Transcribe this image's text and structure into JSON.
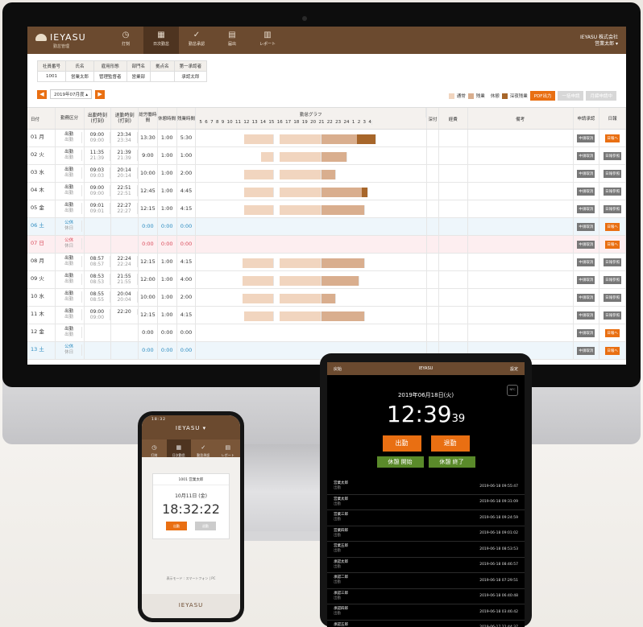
{
  "desktop": {
    "logo": "IEYASU",
    "logo_sub": "勤怠管理",
    "nav": [
      {
        "label": "打刻",
        "icon": "clock-icon"
      },
      {
        "label": "日次勤怠",
        "icon": "calendar-icon",
        "active": true
      },
      {
        "label": "勤怠承認",
        "icon": "check-icon"
      },
      {
        "label": "届出",
        "icon": "doc-icon"
      },
      {
        "label": "レポート",
        "icon": "report-icon"
      }
    ],
    "company": "IEYASU 株式会社",
    "user": "営業太郎 ▾",
    "employee_headers": [
      "社員番号",
      "氏名",
      "雇用形態",
      "部門名",
      "拠点名",
      "第一承認者"
    ],
    "employee_values": [
      "1001",
      "営業太郎",
      "管理監督者",
      "営業部",
      "",
      "承認太郎"
    ],
    "month": "2019年07月度 ▴",
    "legend": {
      "normal": "通常",
      "overtime": "残業",
      "rest": "休憩",
      "late": "深夜残業"
    },
    "pdf": "PDF出力",
    "bulk": "一括申請",
    "monthly": "月締申請中",
    "headers": {
      "date": "日付",
      "type": "勤務区分",
      "in": "出勤時刻 (打刻)",
      "out": "退勤時刻 (打刻)",
      "total": "総労働時間",
      "rest": "休憩時間",
      "over": "残業時間",
      "graph": "勤怠グラフ",
      "hours": "5 6 7 8 9 10 11 12 13 14 15 16 17 18 19 20 21 22 23 24 1 2 3 4",
      "tc": "深付",
      "cost": "経費",
      "note": "備考",
      "approve": "申請承認",
      "daily": "日報"
    },
    "rows": [
      {
        "d": "01 月",
        "t1": "出勤",
        "t2": "出勤",
        "i1": "09:00",
        "i2": "09:00",
        "o1": "23:34",
        "o2": "23:34",
        "tot": "13:30",
        "rest": "1:00",
        "ov": "5:30",
        "a": "中請取消",
        "r": "日報へ",
        "cls": "",
        "s": 0.205,
        "e": 0.772,
        "late": 0.69
      },
      {
        "d": "02 火",
        "t1": "出勤",
        "t2": "出勤",
        "i1": "11:35",
        "i2": "21:39",
        "o1": "21:39",
        "o2": "21:39",
        "tot": "9:00",
        "rest": "1:00",
        "ov": "1:00",
        "a": "中請取消",
        "r": "日報参照",
        "cls": "",
        "s": 0.28,
        "e": 0.65,
        "late": 0
      },
      {
        "d": "03 水",
        "t1": "出勤",
        "t2": "出勤",
        "i1": "09:03",
        "i2": "09:03",
        "o1": "20:14",
        "o2": "20:14",
        "tot": "10:00",
        "rest": "1:00",
        "ov": "2:00",
        "a": "中請取消",
        "r": "日報参照",
        "cls": "",
        "s": 0.205,
        "e": 0.6,
        "late": 0
      },
      {
        "d": "04 木",
        "t1": "出勤",
        "t2": "出勤",
        "i1": "09:00",
        "i2": "09:00",
        "o1": "22:51",
        "o2": "22:51",
        "tot": "12:45",
        "rest": "1:00",
        "ov": "4:45",
        "a": "中請取消",
        "r": "日報参照",
        "cls": "",
        "s": 0.205,
        "e": 0.74,
        "late": 0.71
      },
      {
        "d": "05 金",
        "t1": "出勤",
        "t2": "出勤",
        "i1": "09:01",
        "i2": "09:01",
        "o1": "22:27",
        "o2": "22:27",
        "tot": "12:15",
        "rest": "1:00",
        "ov": "4:15",
        "a": "中請取消",
        "r": "日報参照",
        "cls": "",
        "s": 0.205,
        "e": 0.725,
        "late": 0
      },
      {
        "d": "06 土",
        "t1": "公休",
        "t2": "休日",
        "i1": "",
        "i2": "",
        "o1": "",
        "o2": "",
        "tot": "0:00",
        "rest": "0:00",
        "ov": "0:00",
        "a": "中請取消",
        "r": "日報へ",
        "cls": "blue",
        "s": 0,
        "e": 0,
        "late": 0
      },
      {
        "d": "07 日",
        "t1": "公休",
        "t2": "休日",
        "i1": "",
        "i2": "",
        "o1": "",
        "o2": "",
        "tot": "0:00",
        "rest": "0:00",
        "ov": "0:00",
        "a": "中請取消",
        "r": "日報へ",
        "cls": "red",
        "s": 0,
        "e": 0,
        "late": 0
      },
      {
        "d": "08 月",
        "t1": "出勤",
        "t2": "出勤",
        "i1": "08:57",
        "i2": "08:57",
        "o1": "22:24",
        "o2": "22:24",
        "tot": "12:15",
        "rest": "1:00",
        "ov": "4:15",
        "a": "中請取消",
        "r": "日報参照",
        "cls": "",
        "s": 0.2,
        "e": 0.725,
        "late": 0
      },
      {
        "d": "09 火",
        "t1": "出勤",
        "t2": "出勤",
        "i1": "08:53",
        "i2": "08:53",
        "o1": "21:55",
        "o2": "21:55",
        "tot": "12:00",
        "rest": "1:00",
        "ov": "4:00",
        "a": "中請取消",
        "r": "日報参照",
        "cls": "",
        "s": 0.2,
        "e": 0.7,
        "late": 0
      },
      {
        "d": "10 水",
        "t1": "出勤",
        "t2": "出勤",
        "i1": "08:55",
        "i2": "08:55",
        "o1": "20:04",
        "o2": "20:04",
        "tot": "10:00",
        "rest": "1:00",
        "ov": "2:00",
        "a": "中請取消",
        "r": "日報参照",
        "cls": "",
        "s": 0.2,
        "e": 0.6,
        "late": 0
      },
      {
        "d": "11 木",
        "t1": "出勤",
        "t2": "出勤",
        "i1": "09:00",
        "i2": "09:00",
        "o1": "22:20",
        "o2": "",
        "tot": "12:15",
        "rest": "1:00",
        "ov": "4:15",
        "a": "中請取消",
        "r": "日報参照",
        "cls": "",
        "s": 0.205,
        "e": 0.725,
        "late": 0
      },
      {
        "d": "12 金",
        "t1": "出勤",
        "t2": "出勤",
        "i1": "",
        "i2": "",
        "o1": "",
        "o2": "",
        "tot": "0:00",
        "rest": "0:00",
        "ov": "0:00",
        "a": "中請取消",
        "r": "日報へ",
        "cls": "",
        "s": 0,
        "e": 0,
        "late": 0
      },
      {
        "d": "13 土",
        "t1": "公休",
        "t2": "休日",
        "i1": "",
        "i2": "",
        "o1": "",
        "o2": "",
        "tot": "0:00",
        "rest": "0:00",
        "ov": "0:00",
        "a": "中請取消",
        "r": "日報へ",
        "cls": "blue",
        "s": 0,
        "e": 0,
        "late": 0
      }
    ]
  },
  "phone": {
    "status": "18:32",
    "logo": "IEYASU ▾",
    "nav": [
      "打刻",
      "日次勤怠",
      "勤怠承認",
      "レポート"
    ],
    "user": "1001 営業太郎",
    "date": "10月11日 (金)",
    "time": "18:32:22",
    "in": "出勤",
    "out": "退勤",
    "mode": "表示モード : スマートフォン | PC",
    "footer": "IEYASU"
  },
  "tablet": {
    "back": "戻始",
    "logo": "IEYASU",
    "setting": "設定",
    "date": "2019年06月18日(火)",
    "time": "12:39",
    "sec": "39",
    "nfc": "NFC",
    "in": "出勤",
    "out": "退勤",
    "brk_start": "休憩 開始",
    "brk_end": "休憩 終了",
    "list": [
      {
        "n": "営業太郎",
        "t": "出勤",
        "ts": "2019-06-18 09:55:47"
      },
      {
        "n": "営業太郎",
        "t": "出勤",
        "ts": "2019-06-18 09:31:09"
      },
      {
        "n": "営業三郎",
        "t": "出勤",
        "ts": "2019-06-18 09:24:59"
      },
      {
        "n": "営業四郎",
        "t": "出勤",
        "ts": "2019-06-18 09:01:02"
      },
      {
        "n": "営業五郎",
        "t": "出勤",
        "ts": "2019-06-18 08:53:53"
      },
      {
        "n": "承認太郎",
        "t": "出勤",
        "ts": "2019-06-18 08:46:57"
      },
      {
        "n": "承認二郎",
        "t": "出勤",
        "ts": "2019-06-18 07:29:51"
      },
      {
        "n": "承認三郎",
        "t": "出勤",
        "ts": "2019-06-18 06:40:48"
      },
      {
        "n": "承認四郎",
        "t": "出勤",
        "ts": "2019-06-18 03:46:42"
      },
      {
        "n": "承認五郎",
        "t": "出勤",
        "ts": "2019-06-17 22:44:37"
      }
    ]
  }
}
